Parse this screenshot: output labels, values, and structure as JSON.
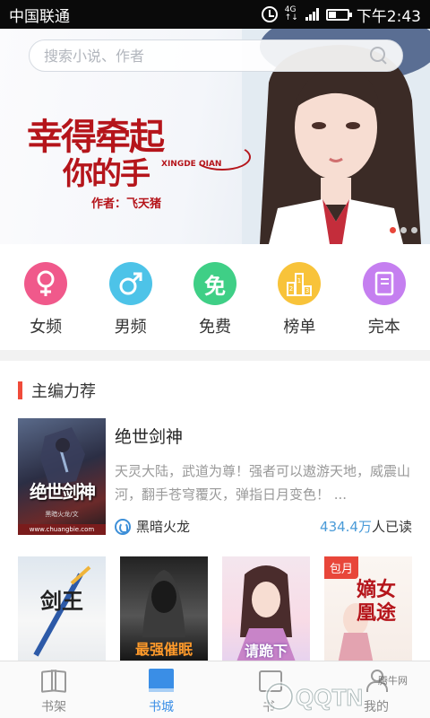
{
  "status_bar": {
    "carrier": "中国联通",
    "network": "4G",
    "time": "下午2:43"
  },
  "search": {
    "placeholder": "搜索小说、作者"
  },
  "banner": {
    "title_line1": "幸得牵起",
    "title_line2": "你的手",
    "pinyin": "XINGDE QIAN",
    "author": "作者：飞天猪",
    "page_count": 3,
    "active_page": 0
  },
  "categories": [
    {
      "label": "女频",
      "icon": "female-icon",
      "glyph": "♀",
      "color": "#f0598b"
    },
    {
      "label": "男频",
      "icon": "male-icon",
      "glyph": "♂",
      "color": "#4dc3e8"
    },
    {
      "label": "免费",
      "icon": "free-icon",
      "glyph": "免",
      "color": "#3fcf86"
    },
    {
      "label": "榜单",
      "icon": "ranking-icon",
      "glyph": "",
      "color": "#f8c33a"
    },
    {
      "label": "完本",
      "icon": "completed-book-icon",
      "glyph": "",
      "color": "#c57ff0"
    }
  ],
  "section": {
    "title": "主编力荐"
  },
  "featured": {
    "name": "绝世剑神",
    "description": "天灵大陆，武道为尊！强者可以遨游天地，威震山河，翻手苍穹覆灭，弹指日月变色！ ...",
    "author": "黑暗火龙",
    "reads_number": "434.4万",
    "reads_suffix": "人已读",
    "cover_title": "绝世剑神",
    "cover_author": "黑暗火龙/文",
    "cover_url": "www.chuangbie.com"
  },
  "covers": [
    {
      "title": "剑王",
      "badge": ""
    },
    {
      "title": "最强催眠",
      "badge": ""
    },
    {
      "title": "请跪下",
      "badge": ""
    },
    {
      "title": "嫡女凰途",
      "badge": "包月"
    }
  ],
  "tabbar": [
    {
      "label": "书架",
      "icon": "bookshelf-icon",
      "active": false
    },
    {
      "label": "书城",
      "icon": "bookstore-icon",
      "active": true
    },
    {
      "label": "书",
      "icon": "discover-icon",
      "active": false
    },
    {
      "label": "我的",
      "icon": "profile-icon",
      "active": false
    }
  ],
  "watermark": {
    "site": "腾牛网",
    "text": "QQTN"
  }
}
